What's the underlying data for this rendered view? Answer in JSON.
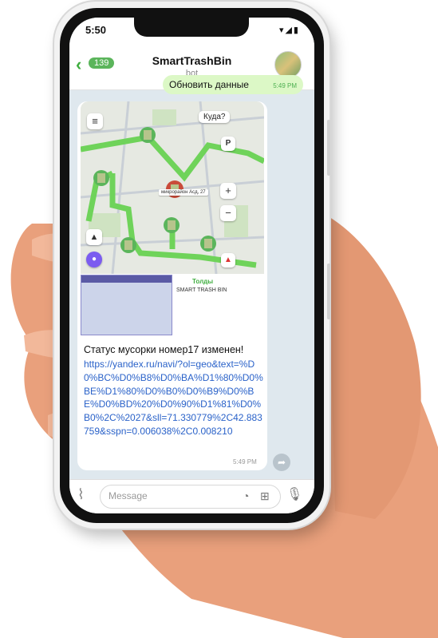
{
  "status_bar": {
    "time": "5:50",
    "icons": "▾◢▮"
  },
  "header": {
    "back_count": "139",
    "title": "SmartTrashBin",
    "subtitle": "bot"
  },
  "messages": {
    "outgoing": {
      "text": "Обновить данные",
      "time": "5:49 PM"
    },
    "incoming": {
      "map_search": "Куда?",
      "map_address": "микрорайон Асд, 27",
      "preview_site": "Толды",
      "preview_title": "SMART TRASH BIN",
      "status_text": "Статус мусорки номер17 изменен!",
      "link": "https://yandex.ru/navi/?ol=geo&text=%D0%BC%D0%B8%D0%BA%D1%80%D0%BE%D1%80%D0%B0%D0%B9%D0%BE%D0%BD%20%D0%90%D1%81%D0%B0%2C%2027&sll=71.330779%2C42.883759&sspn=0.006038%2C0.008210",
      "time": "5:49 PM"
    }
  },
  "input": {
    "placeholder": "Message"
  },
  "colors": {
    "accent_green": "#5bb55b",
    "route": "#6fd35a",
    "link": "#2a62c9"
  }
}
